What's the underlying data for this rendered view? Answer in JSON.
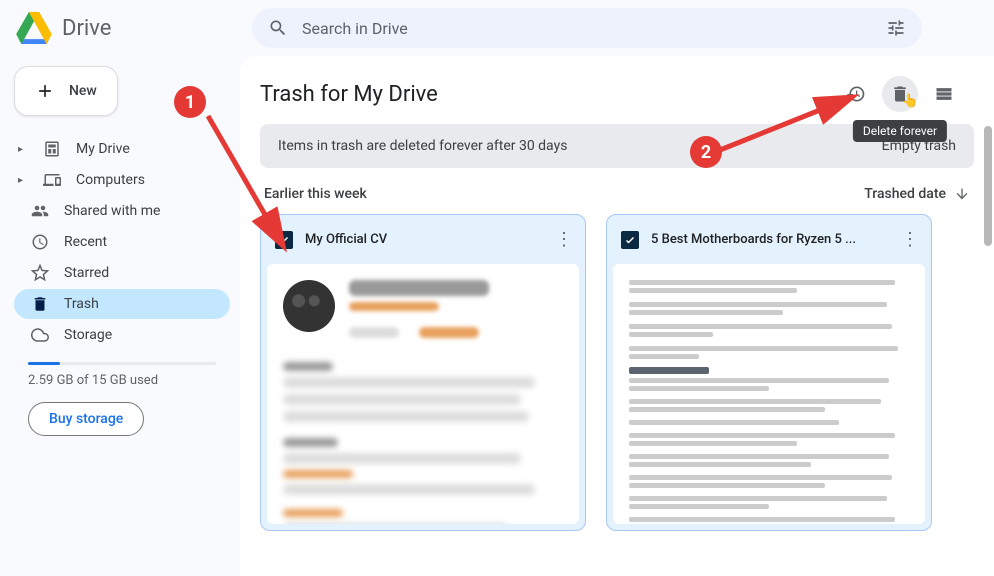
{
  "app": {
    "name": "Drive"
  },
  "search": {
    "placeholder": "Search in Drive"
  },
  "new_button": {
    "label": "New"
  },
  "sidebar": {
    "items": [
      {
        "label": "My Drive",
        "icon": "my-drive-icon",
        "arrow": true
      },
      {
        "label": "Computers",
        "icon": "computers-icon",
        "arrow": true
      },
      {
        "label": "Shared with me",
        "icon": "shared-icon"
      },
      {
        "label": "Recent",
        "icon": "recent-icon"
      },
      {
        "label": "Starred",
        "icon": "starred-icon"
      },
      {
        "label": "Trash",
        "icon": "trash-icon",
        "active": true
      },
      {
        "label": "Storage",
        "icon": "storage-icon"
      }
    ],
    "storage_text": "2.59 GB of 15 GB used",
    "buy_label": "Buy storage"
  },
  "main": {
    "title": "Trash for My Drive",
    "info_message": "Items in trash are deleted forever after 30 days",
    "empty_trash_label": "Empty trash",
    "section_label": "Earlier this week",
    "sort_label": "Trashed date",
    "tooltip": "Delete forever",
    "files": [
      {
        "name": "My Official CV",
        "selected": true
      },
      {
        "name": "5 Best Motherboards for Ryzen 5 ...",
        "selected": true
      }
    ]
  },
  "annotations": {
    "step1": "1",
    "step2": "2"
  }
}
